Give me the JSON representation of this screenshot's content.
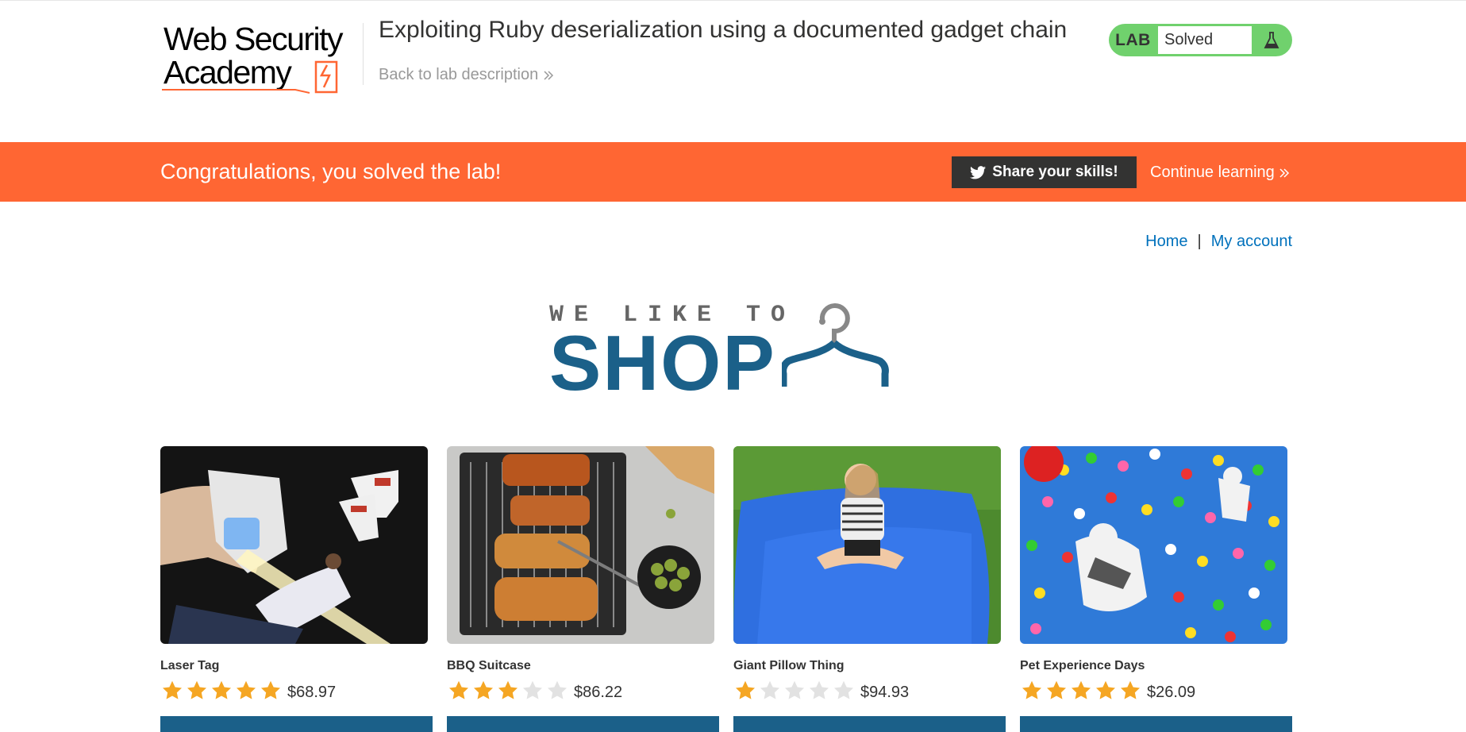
{
  "header": {
    "logo_line1": "Web Security",
    "logo_line2": "Academy",
    "lab_title": "Exploiting Ruby deserialization using a documented gadget chain",
    "back_link": "Back to lab description",
    "lab_badge": "LAB",
    "lab_status": "Solved"
  },
  "banner": {
    "message": "Congratulations, you solved the lab!",
    "share_label": "Share your skills!",
    "continue_label": "Continue learning"
  },
  "nav": {
    "home": "Home",
    "separator": "|",
    "account": "My account"
  },
  "shop_logo": {
    "tagline": "WE LIKE TO",
    "word": "SHOP"
  },
  "products": [
    {
      "name": "Laser Tag",
      "rating": 5,
      "price": "$68.97"
    },
    {
      "name": "BBQ Suitcase",
      "rating": 3,
      "price": "$86.22"
    },
    {
      "name": "Giant Pillow Thing",
      "rating": 1,
      "price": "$94.93"
    },
    {
      "name": "Pet Experience Days",
      "rating": 5,
      "price": "$26.09"
    }
  ],
  "colors": {
    "accent_orange": "#ff6633",
    "solved_green": "#70d16d",
    "link_blue": "#0071bc",
    "shop_blue": "#1b6089",
    "star_gold": "#f5a623",
    "star_empty": "#e2e2e2"
  }
}
